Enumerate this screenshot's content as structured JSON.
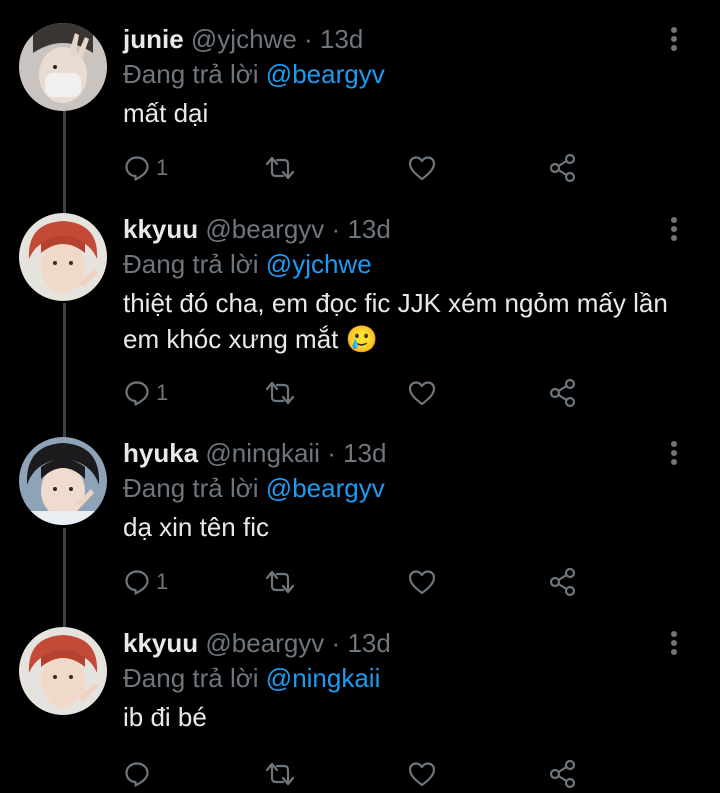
{
  "tweets": [
    {
      "name": "junie",
      "handle": "@yjchwe",
      "separator": "·",
      "time": "13d",
      "reply_prefix": "Đang trả lời",
      "reply_to": "@beargyv",
      "text": "mất dại",
      "reply_count": "1",
      "avatar_icon": "avatar-junie"
    },
    {
      "name": "kkyuu",
      "handle": "@beargyv",
      "separator": "·",
      "time": "13d",
      "reply_prefix": "Đang trả lời",
      "reply_to": "@yjchwe",
      "text": "thiệt đó cha, em đọc fic JJK xém ngỏm mấy lần em khóc xưng mắt 🥲",
      "reply_count": "1",
      "avatar_icon": "avatar-kkyuu"
    },
    {
      "name": "hyuka",
      "handle": "@ningkaii",
      "separator": "·",
      "time": "13d",
      "reply_prefix": "Đang trả lời",
      "reply_to": "@beargyv",
      "text": "dạ xin tên fic",
      "reply_count": "1",
      "avatar_icon": "avatar-hyuka"
    },
    {
      "name": "kkyuu",
      "handle": "@beargyv",
      "separator": "·",
      "time": "13d",
      "reply_prefix": "Đang trả lời",
      "reply_to": "@ningkaii",
      "text": "ib đi bé",
      "reply_count": "",
      "avatar_icon": "avatar-kkyuu"
    }
  ],
  "colors": {
    "background": "#000000",
    "accent": "#1d9bf0",
    "muted": "#6e767d",
    "text": "#e7e9ea",
    "thread_line": "#3d4248"
  }
}
